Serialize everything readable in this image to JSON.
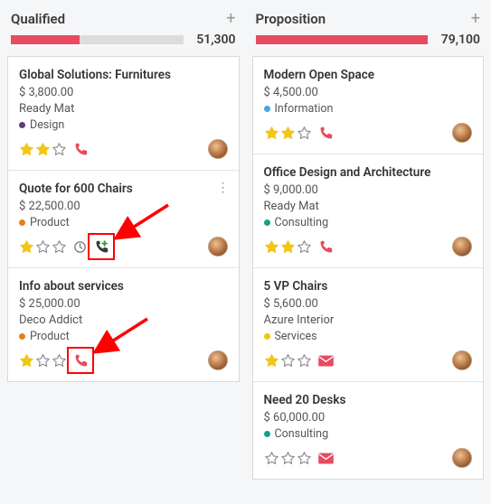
{
  "columns": [
    {
      "title": "Qualified",
      "total": "51,300",
      "fill_pct": 40,
      "cards": [
        {
          "title": "Global Solutions: Furnitures",
          "amount": "$ 3,800.00",
          "customer": "Ready Mat",
          "tag": {
            "label": "Design",
            "color": "#5b3e7b"
          },
          "stars": 2,
          "action_icon": "phone",
          "action_color": "#e84a5f",
          "kebab": false
        },
        {
          "title": "Quote for 600 Chairs",
          "amount": "$ 22,500.00",
          "customer": "",
          "tag": {
            "label": "Product",
            "color": "#e67e22"
          },
          "stars": 1,
          "clock": true,
          "action_icon": "phone-plus",
          "action_color": "#3a3a3a",
          "kebab": true,
          "highlight": "action",
          "arrow_to": "action"
        },
        {
          "title": "Info about services",
          "amount": "$ 25,000.00",
          "customer": "Deco Addict",
          "tag": {
            "label": "Product",
            "color": "#e67e22"
          },
          "stars": 1,
          "action_icon": "phone",
          "action_color": "#e84a5f",
          "kebab": false,
          "highlight": "phone",
          "arrow_to": "phone"
        }
      ]
    },
    {
      "title": "Proposition",
      "total": "79,100",
      "fill_pct": 100,
      "cards": [
        {
          "title": "Modern Open Space",
          "amount": "$ 4,500.00",
          "customer": "",
          "tag": {
            "label": "Information",
            "color": "#4aa3df"
          },
          "stars": 2,
          "action_icon": "phone",
          "action_color": "#e84a5f"
        },
        {
          "title": "Office Design and Architecture",
          "amount": "$ 9,000.00",
          "customer": "Ready Mat",
          "tag": {
            "label": "Consulting",
            "color": "#16a085"
          },
          "stars": 2,
          "action_icon": "phone",
          "action_color": "#e84a5f"
        },
        {
          "title": "5 VP Chairs",
          "amount": "$ 5,600.00",
          "customer": "Azure Interior",
          "tag": {
            "label": "Services",
            "color": "#f1c40f"
          },
          "stars": 1,
          "action_icon": "envelope",
          "action_color": "#e84a5f"
        },
        {
          "title": "Need 20 Desks",
          "amount": "$ 60,000.00",
          "customer": "",
          "tag": {
            "label": "Consulting",
            "color": "#16a085"
          },
          "stars": 0,
          "action_icon": "envelope",
          "action_color": "#e84a5f"
        }
      ]
    }
  ]
}
